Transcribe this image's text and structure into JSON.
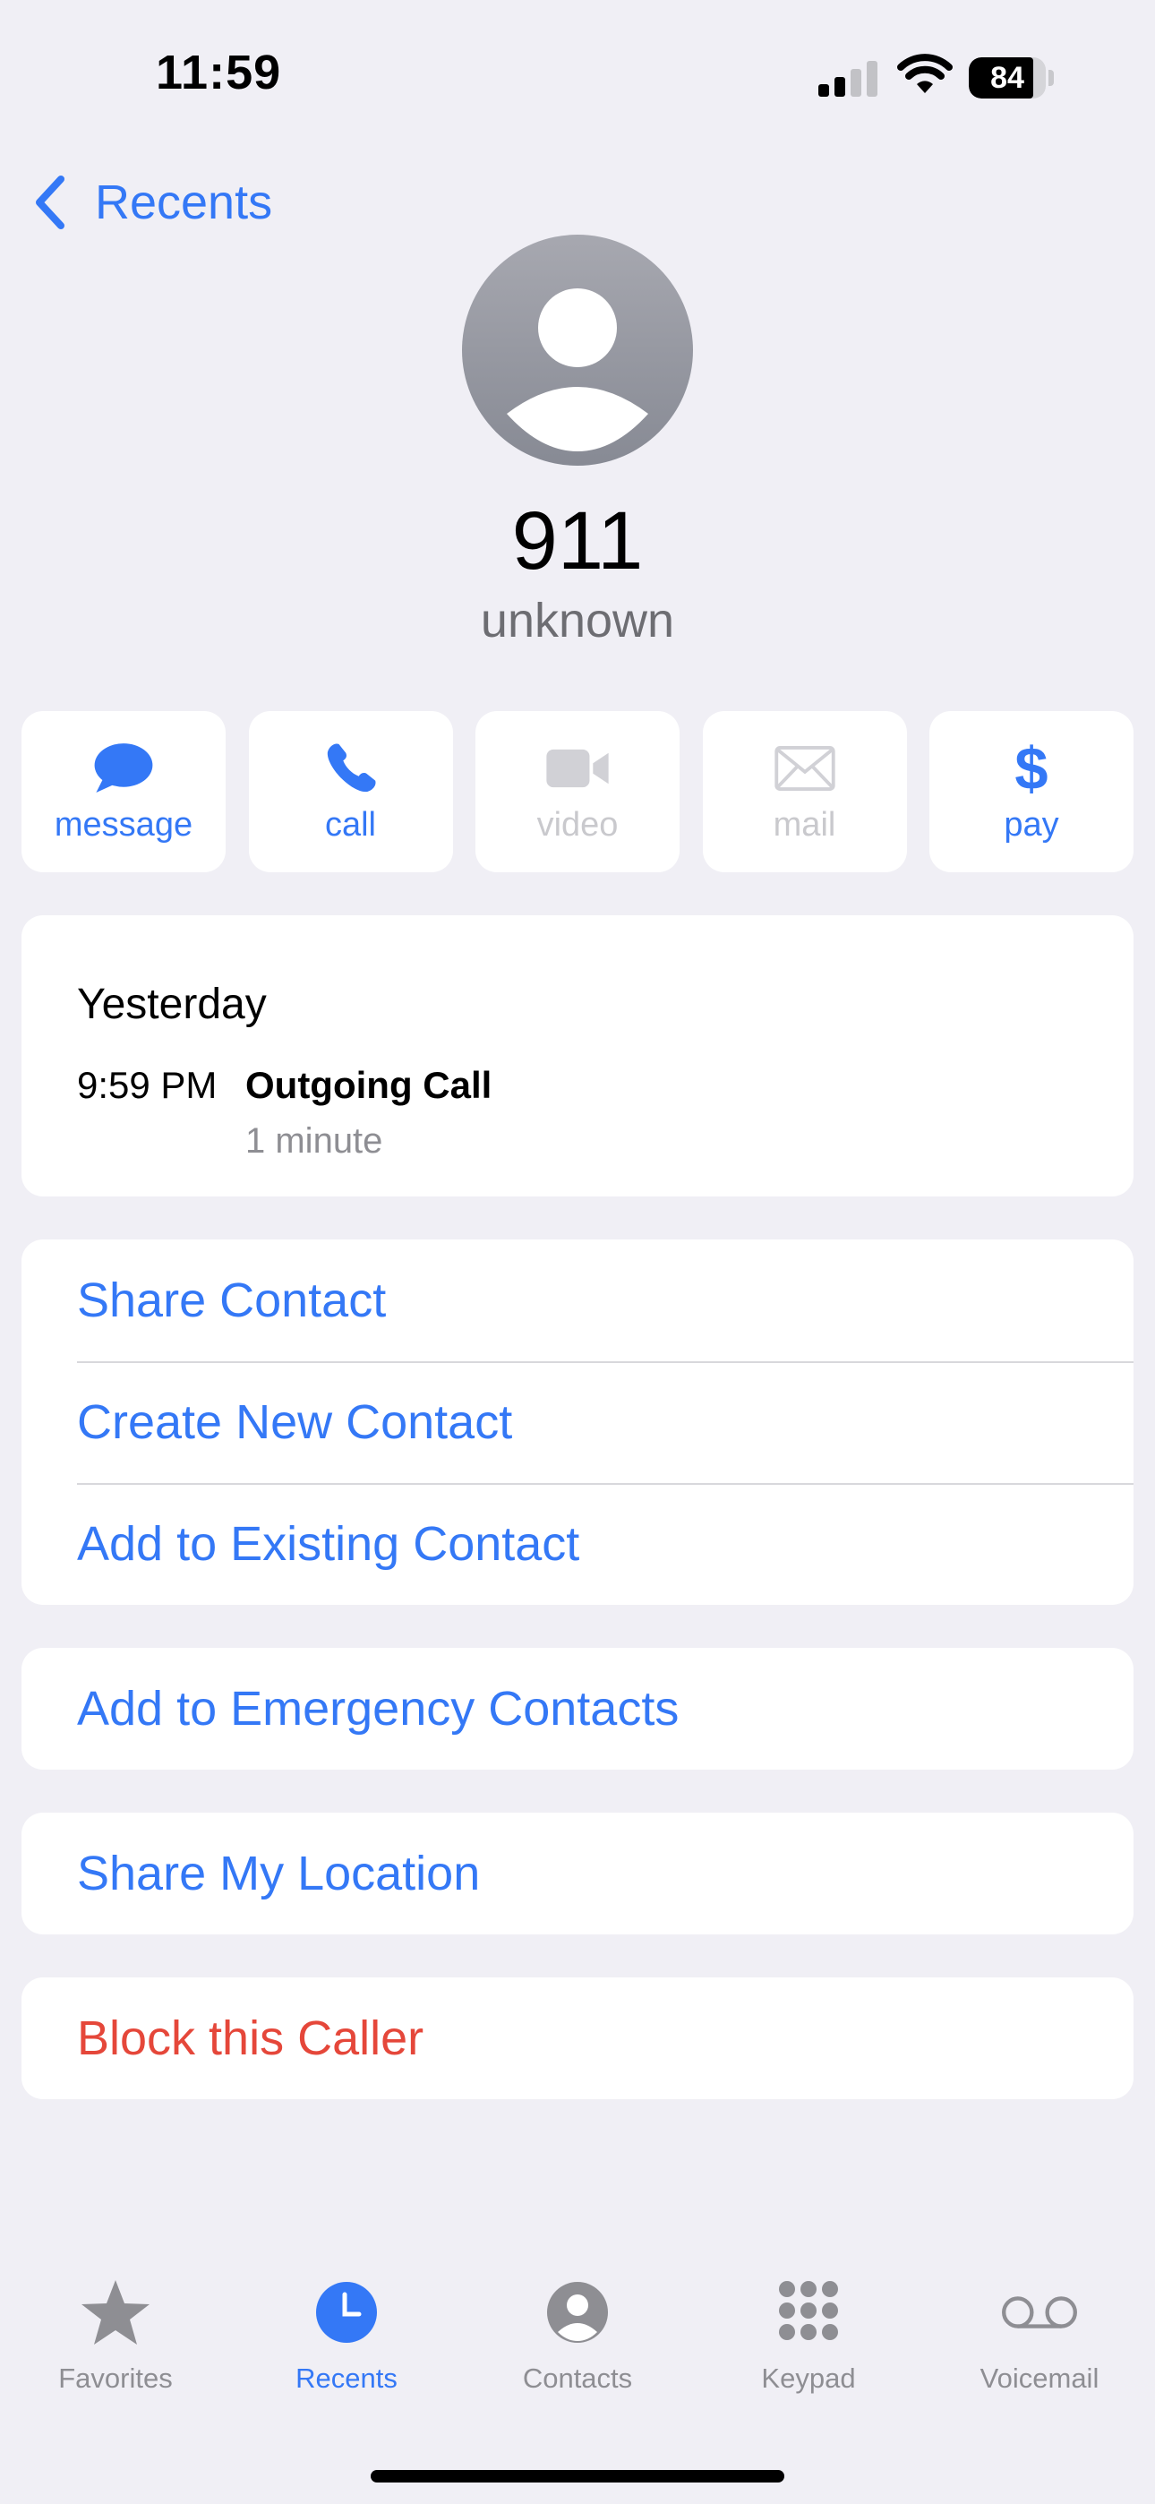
{
  "status_bar": {
    "time": "11:59",
    "battery_level": "84",
    "battery_fraction": 0.84
  },
  "nav": {
    "back_label": "Recents"
  },
  "contact": {
    "number": "911",
    "label": "unknown"
  },
  "actions": [
    {
      "label": "message",
      "icon": "message-bubble-icon",
      "enabled": true
    },
    {
      "label": "call",
      "icon": "phone-icon",
      "enabled": true
    },
    {
      "label": "video",
      "icon": "video-camera-icon",
      "enabled": false
    },
    {
      "label": "mail",
      "icon": "mail-envelope-icon",
      "enabled": false
    },
    {
      "label": "pay",
      "icon": "dollar-icon",
      "enabled": true
    }
  ],
  "call_history": {
    "day": "Yesterday",
    "time": "9:59 PM",
    "type": "Outgoing Call",
    "duration": "1 minute"
  },
  "contact_options": [
    "Share Contact",
    "Create New Contact",
    "Add to Existing Contact"
  ],
  "emergency_option": "Add to Emergency Contacts",
  "location_option": "Share My Location",
  "block_option": "Block this Caller",
  "tab_bar": [
    {
      "label": "Favorites",
      "icon": "star-icon",
      "active": false
    },
    {
      "label": "Recents",
      "icon": "clock-icon",
      "active": true
    },
    {
      "label": "Contacts",
      "icon": "person-circle-icon",
      "active": false
    },
    {
      "label": "Keypad",
      "icon": "keypad-icon",
      "active": false
    },
    {
      "label": "Voicemail",
      "icon": "voicemail-icon",
      "active": false
    }
  ],
  "colors": {
    "accent": "#3478f6",
    "destructive": "#e5473a",
    "background": "#f0eff5",
    "disabled": "#c9c9cd",
    "inactive_tab": "#8e8e93"
  }
}
